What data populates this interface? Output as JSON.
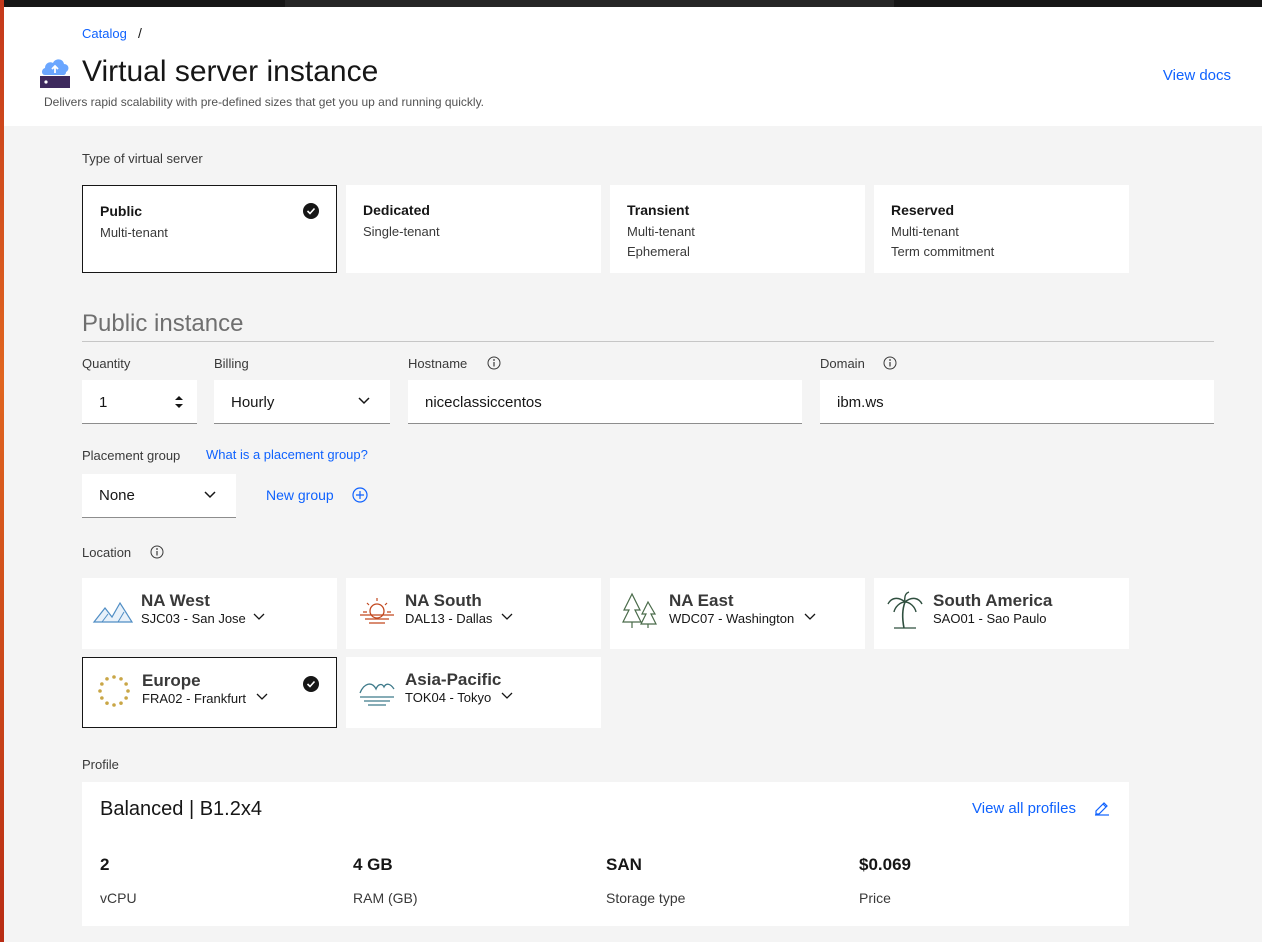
{
  "breadcrumb": {
    "catalog": "Catalog",
    "separator": "/"
  },
  "page": {
    "title": "Virtual server instance",
    "subtitle": "Delivers rapid scalability with pre-defined sizes that get you up and running quickly.",
    "view_docs": "View docs"
  },
  "server_type": {
    "label": "Type of virtual server",
    "selected": "Public",
    "options": [
      {
        "title": "Public",
        "line1": "Multi-tenant",
        "line2": ""
      },
      {
        "title": "Dedicated",
        "line1": "Single-tenant",
        "line2": ""
      },
      {
        "title": "Transient",
        "line1": "Multi-tenant",
        "line2": "Ephemeral"
      },
      {
        "title": "Reserved",
        "line1": "Multi-tenant",
        "line2": "Term commitment"
      }
    ]
  },
  "instance": {
    "section_title": "Public instance",
    "quantity": {
      "label": "Quantity",
      "value": "1"
    },
    "billing": {
      "label": "Billing",
      "value": "Hourly"
    },
    "hostname": {
      "label": "Hostname",
      "value": "niceclassiccentos"
    },
    "domain": {
      "label": "Domain",
      "value": "ibm.ws"
    }
  },
  "placement": {
    "label": "Placement group",
    "help_link": "What is a placement group?",
    "value": "None",
    "new_group": "New group"
  },
  "location": {
    "label": "Location",
    "selected": "Europe",
    "regions": [
      {
        "name": "NA West",
        "dc": "SJC03 - San Jose",
        "icon": "mountains-icon"
      },
      {
        "name": "NA South",
        "dc": "DAL13 - Dallas",
        "icon": "sunset-icon"
      },
      {
        "name": "NA East",
        "dc": "WDC07 - Washington",
        "icon": "pine-trees-icon"
      },
      {
        "name": "South America",
        "dc": "SAO01 - Sao Paulo",
        "icon": "palm-tree-icon"
      },
      {
        "name": "Europe",
        "dc": "FRA02 - Frankfurt",
        "icon": "star-circle-icon"
      },
      {
        "name": "Asia-Pacific",
        "dc": "TOK04 - Tokyo",
        "icon": "wave-icon"
      }
    ]
  },
  "profile": {
    "label": "Profile",
    "title": "Balanced | B1.2x4",
    "view_all": "View all profiles",
    "specs": [
      {
        "value": "2",
        "label": "vCPU"
      },
      {
        "value": "4 GB",
        "label": "RAM (GB)"
      },
      {
        "value": "SAN",
        "label": "Storage type"
      },
      {
        "value": "$0.069",
        "label": "Price"
      }
    ]
  },
  "colors": {
    "accent": "#0f62fe",
    "selected_border": "#161616",
    "background": "#f4f4f4"
  }
}
